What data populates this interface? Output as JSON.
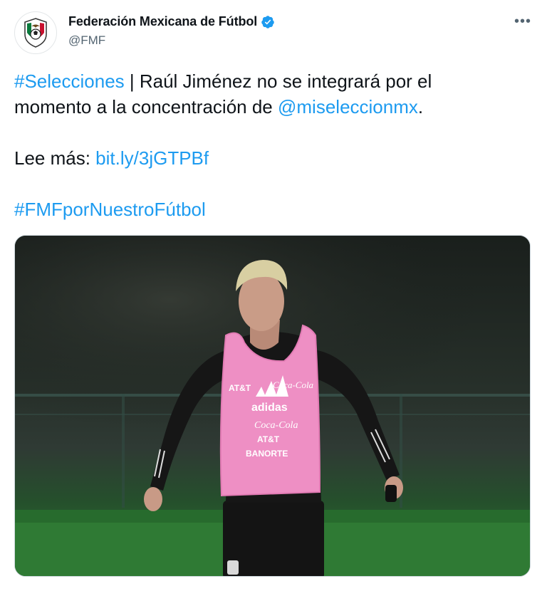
{
  "account": {
    "display_name": "Federación Mexicana de Fútbol",
    "handle": "@FMF",
    "verified": true,
    "avatar_icon": "fmf-crest-icon"
  },
  "more_icon": "more-horizontal-icon",
  "tweet": {
    "hashtag_selecciones": "#Selecciones",
    "line1_rest": " | Raúl Jiménez no se integrará por el",
    "line2_text": "momento a la concentración de ",
    "mention": "@miseleccionmx",
    "line2_end": ".",
    "read_more_label": "Lee más: ",
    "read_more_link": "bit.ly/3jGTPBf",
    "hashtag_footer": "#FMFporNuestroFútbol"
  },
  "photo": {
    "bib_sponsors": [
      "AT&T",
      "Coca-Cola",
      "adidas",
      "Coca-Cola",
      "AT&T",
      "BANORTE"
    ]
  },
  "colors": {
    "link": "#1d9bf0",
    "text": "#0f1419",
    "secondary": "#536471",
    "bib_pink": "#ee8fc4"
  }
}
